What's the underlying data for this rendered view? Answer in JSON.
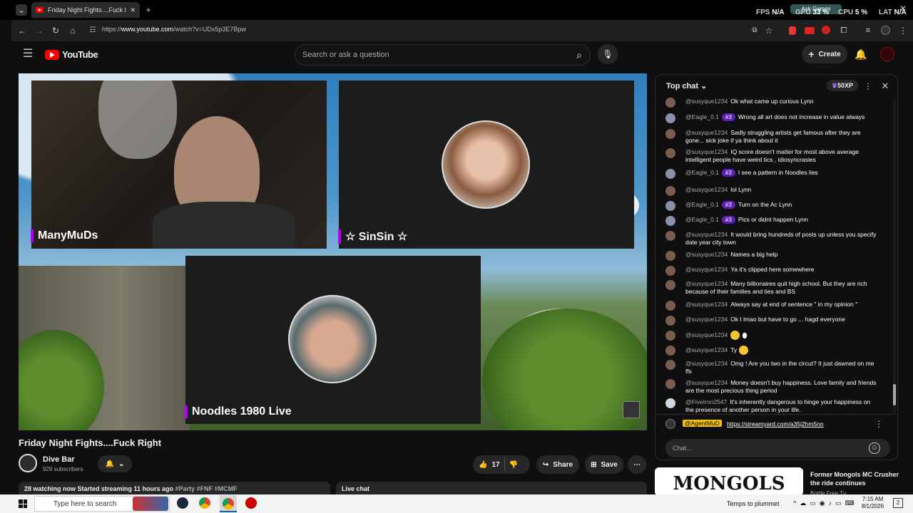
{
  "browser": {
    "tab_title": "Friday Night Fights....Fuck Right",
    "url_prefix": "https://",
    "url_domain": "www.youtube.com",
    "url_path": "/watch?v=UDx5p3E7Bpw",
    "ask_gemini": "Ask Gemini",
    "hud": {
      "fps_label": "FPS",
      "fps_value": "N/A",
      "gpu_label": "GPU",
      "gpu_value": "33 %",
      "cpu_label": "CPU",
      "cpu_value": "5 %",
      "lat_label": "LAT",
      "lat_value": "N/A"
    }
  },
  "youtube": {
    "logo": "YouTube",
    "search_placeholder": "Search or ask a question",
    "create_label": "Create"
  },
  "video": {
    "cams": [
      {
        "name": "ManyMuDs"
      },
      {
        "name": "☆ SinSin ☆"
      },
      {
        "name": "Noodles 1980 Live"
      }
    ]
  },
  "info": {
    "title": "Friday Night Fights....Fuck Right",
    "channel": "Dive Bar",
    "subscribers": "929 subscribers",
    "likes": "17",
    "share": "Share",
    "save": "Save",
    "stats": "28 watching now  Started streaming 11 hours ago",
    "tags": "#Party #FNF #MCMF",
    "live_chat": "Live chat"
  },
  "chat": {
    "header": "Top chat",
    "xp": "50XP",
    "messages": [
      {
        "user": "@susyque1234",
        "badge": "",
        "text": "Ok what came up curious Lynn"
      },
      {
        "user": "@Eagle_0.1",
        "badge": "#3",
        "text": "Wrong all art does not increase in value always"
      },
      {
        "user": "@susyque1234",
        "badge": "",
        "text": "Sadly struggling artists get famous after they are gone... sick joke if ya think about it"
      },
      {
        "user": "@susyque1234",
        "badge": "",
        "text": "IQ score doesn't matter for most above average intelligent people have weird tics , idiosyncrasies"
      },
      {
        "user": "@Eagle_0.1",
        "badge": "#3",
        "text": "I see a pattern in Noodles lies"
      },
      {
        "user": "@susyque1234",
        "badge": "",
        "text": "lol Lynn"
      },
      {
        "user": "@Eagle_0.1",
        "badge": "#3",
        "text": "Turn on the Ac Lynn"
      },
      {
        "user": "@Eagle_0.1",
        "badge": "#3",
        "text": "Pics or didnt happen Lynn"
      },
      {
        "user": "@susyque1234",
        "badge": "",
        "text": "It would bring hundreds of posts up unless you specify date year city town"
      },
      {
        "user": "@susyque1234",
        "badge": "",
        "text": "Names a big help"
      },
      {
        "user": "@susyque1234",
        "badge": "",
        "text": "Ya it's clipped here somewhere"
      },
      {
        "user": "@susyque1234",
        "badge": "",
        "text": "Many billionaires quit high school. But they are rich because of their families and ties and BS"
      },
      {
        "user": "@susyque1234",
        "badge": "",
        "text": "Always say at end of sentence \" in my opinion \""
      },
      {
        "user": "@susyque1234",
        "badge": "",
        "text": "Ok I lmao but have to go ... hagd everyone"
      },
      {
        "user": "@susyque1234",
        "badge": "",
        "text": ""
      },
      {
        "user": "@susyque1234",
        "badge": "",
        "text": "Ty"
      },
      {
        "user": "@susyque1234",
        "badge": "",
        "text": "Omg ! Are you two in the circut? It just dawned on me ffs"
      },
      {
        "user": "@susyque1234",
        "badge": "",
        "text": "Money doesn't buy happiness. Love family and friends are the most precious thing period"
      },
      {
        "user": "@FiveIron2547",
        "badge": "",
        "text": "It's inherently dangerous to hinge your happiness on the presence of another person in your life."
      }
    ],
    "pinned_user": "@AgentMuD",
    "pinned_link": "https://streamyard.com/a35j2hm5nn",
    "input_placeholder": "Chat..."
  },
  "recommended": {
    "thumb_text": "MONGOLS",
    "title": "Former Mongols MC Crusher the ride continues",
    "channel": "Bottle Free Tv"
  },
  "taskbar": {
    "search_placeholder": "Type here to search",
    "weather": "Temps to plummet",
    "time": "7:15 AM",
    "date": "8/1/2026",
    "notif_count": "2"
  }
}
